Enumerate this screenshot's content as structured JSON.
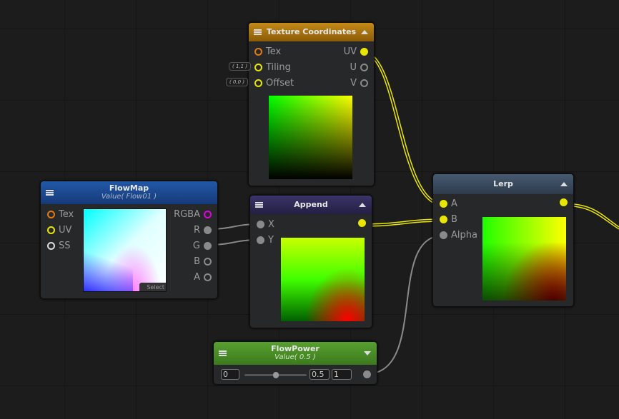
{
  "colors": {
    "yellow": "#e9e600",
    "orange": "#e07a14",
    "magenta": "#e000e0",
    "gray": "#8a8a8a",
    "texcoord_header": "#b07a10",
    "flowmap_header": "#1d4a90",
    "append_header": "#2f2a55",
    "lerp_header": "#3b4b5e",
    "flowpower_header": "#4b8a28"
  },
  "texcoord": {
    "title": "Texture Coordinates",
    "inputs": [
      "Tex",
      "Tiling",
      "Offset"
    ],
    "outputs": [
      "UV",
      "U",
      "V"
    ],
    "tiling_value": "( 1,1 )",
    "offset_value": "( 0,0 )"
  },
  "flowmap": {
    "title": "FlowMap",
    "subtitle": "Value( Flow01 )",
    "inputs": [
      "Tex",
      "UV",
      "SS"
    ],
    "outputs": [
      "RGBA",
      "R",
      "G",
      "B",
      "A"
    ],
    "select_label": "Select"
  },
  "append": {
    "title": "Append",
    "inputs": [
      "X",
      "Y"
    ]
  },
  "lerp": {
    "title": "Lerp",
    "inputs": [
      "A",
      "B",
      "Alpha"
    ]
  },
  "flowpower": {
    "title": "FlowPower",
    "subtitle": "Value( 0.5 )",
    "min": "0",
    "value": "0.5",
    "max": "1",
    "slider_fraction": 0.5
  }
}
